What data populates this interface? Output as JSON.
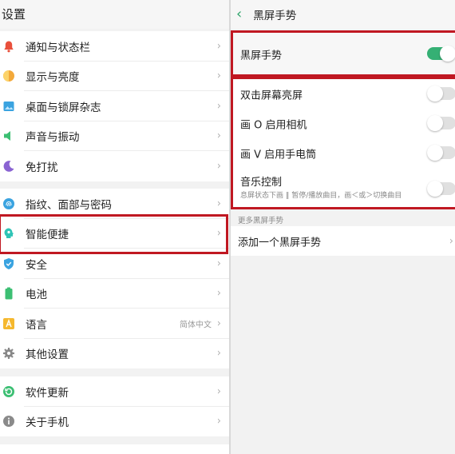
{
  "left": {
    "title": "设置",
    "group1": [
      {
        "label": "通知与状态栏",
        "icon": "bell-icon"
      },
      {
        "label": "显示与亮度",
        "icon": "brightness-icon"
      },
      {
        "label": "桌面与锁屏杂志",
        "icon": "wallpaper-icon"
      },
      {
        "label": "声音与振动",
        "icon": "speaker-icon"
      },
      {
        "label": "免打扰",
        "icon": "moon-icon"
      }
    ],
    "group2": [
      {
        "label": "指纹、面部与密码",
        "icon": "fingerprint-icon"
      },
      {
        "label": "智能便捷",
        "icon": "smart-assist-icon"
      },
      {
        "label": "安全",
        "icon": "shield-icon"
      },
      {
        "label": "电池",
        "icon": "battery-icon"
      },
      {
        "label": "语言",
        "icon": "language-icon",
        "value": "简体中文"
      },
      {
        "label": "其他设置",
        "icon": "gear-icon"
      }
    ],
    "group3": [
      {
        "label": "软件更新",
        "icon": "update-icon"
      },
      {
        "label": "关于手机",
        "icon": "info-icon"
      }
    ]
  },
  "right": {
    "back_icon": "back-chevron-icon",
    "title": "黑屏手势",
    "master": {
      "label": "黑屏手势",
      "on": true
    },
    "items": [
      {
        "label": "双击屏幕亮屏",
        "on": false
      },
      {
        "label": "画 O 启用相机",
        "on": false
      },
      {
        "label": "画 V 启用手电筒",
        "on": false
      },
      {
        "label": "音乐控制",
        "sub": "息屏状态下画 ‖ 暂停/播放曲目，画＜或＞切换曲目",
        "on": false
      }
    ],
    "more_label": "更多黑屏手势",
    "add_label": "添加一个黑屏手势"
  },
  "colors": {
    "accent": "#35b074",
    "highlight": "#c01822"
  }
}
